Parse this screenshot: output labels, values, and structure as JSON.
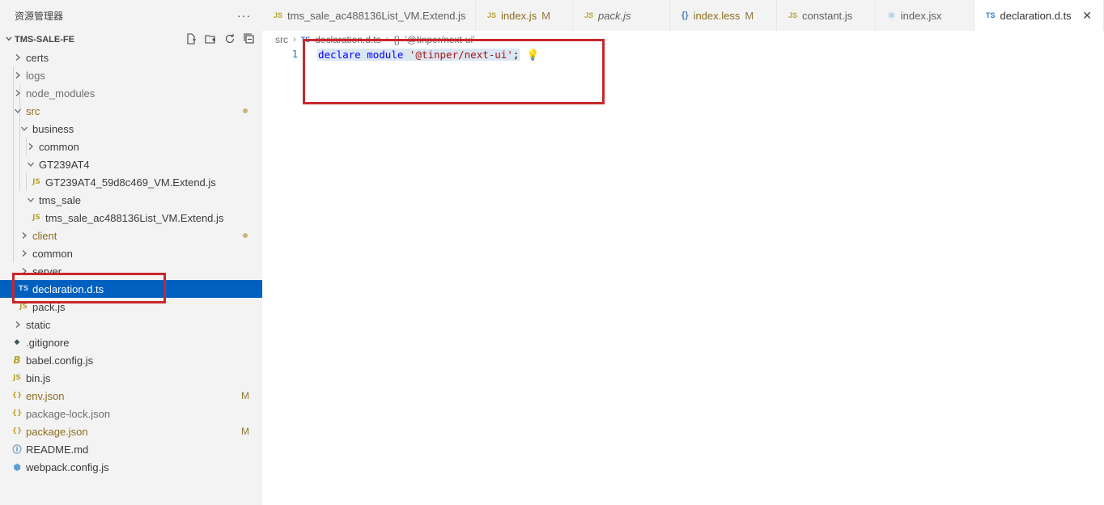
{
  "sidebar": {
    "title": "资源管理器",
    "more": "···",
    "project": "TMS-SALE-FE",
    "items": [
      {
        "label": "certs",
        "icon": "chevron-right",
        "color": "default"
      },
      {
        "label": "logs",
        "icon": "chevron-right",
        "color": "grey"
      },
      {
        "label": "node_modules",
        "icon": "chevron-right",
        "color": "grey"
      },
      {
        "label": "src",
        "icon": "chevron-down",
        "color": "yellow"
      },
      {
        "label": "business",
        "icon": "chevron-down"
      },
      {
        "label": "common",
        "icon": "chevron-right"
      },
      {
        "label": "GT239AT4",
        "icon": "chevron-down"
      },
      {
        "label": "GT239AT4_59d8c469_VM.Extend.js",
        "icon": "JS"
      },
      {
        "label": "tms_sale",
        "icon": "chevron-down"
      },
      {
        "label": "tms_sale_ac488136List_VM.Extend.js",
        "icon": "JS"
      },
      {
        "label": "client",
        "icon": "chevron-right",
        "color": "yellow"
      },
      {
        "label": "common",
        "icon": "chevron-right"
      },
      {
        "label": "server",
        "icon": "chevron-right"
      },
      {
        "label": "declaration.d.ts",
        "icon": "TS"
      },
      {
        "label": "pack.js",
        "icon": "JS"
      },
      {
        "label": "static",
        "icon": "chevron-right"
      },
      {
        "label": ".gitignore",
        "icon": "git-icon"
      },
      {
        "label": "babel.config.js",
        "icon": "babel-icon"
      },
      {
        "label": "bin.js",
        "icon": "JS"
      },
      {
        "label": "env.json",
        "icon": "{}",
        "color": "yellow",
        "badge": "M"
      },
      {
        "label": "package-lock.json",
        "icon": "{}",
        "color": "grey"
      },
      {
        "label": "package.json",
        "icon": "{}",
        "color": "yellow",
        "badge": "M"
      },
      {
        "label": "README.md",
        "icon": "info-icon"
      },
      {
        "label": "webpack.config.js",
        "icon": "webpack-icon"
      }
    ]
  },
  "tabs": [
    {
      "label": "tms_sale_ac488136List_VM.Extend.js",
      "icon": "JS"
    },
    {
      "label": "index.js",
      "icon": "JS",
      "modified": "M"
    },
    {
      "label": "pack.js",
      "icon": "JS"
    },
    {
      "label": "index.less",
      "icon": "{}",
      "modified": "M"
    },
    {
      "label": "constant.js",
      "icon": "JS"
    },
    {
      "label": "index.jsx",
      "icon": "react-icon"
    },
    {
      "label": "declaration.d.ts",
      "icon": "TS",
      "close": "✕"
    }
  ],
  "breadcrumb": {
    "root": "src",
    "file": "declaration.d.ts",
    "symbol": "'@tinper/next-ui'"
  },
  "editor": {
    "line_number": "1",
    "code_keyword1": "declare",
    "code_keyword2": "module",
    "code_string": "'@tinper/next-ui'",
    "code_punct": ";"
  },
  "colors": {
    "selection": "#0060c0",
    "annotation_red": "#c8282d",
    "modified_dot": "#c9b578"
  }
}
